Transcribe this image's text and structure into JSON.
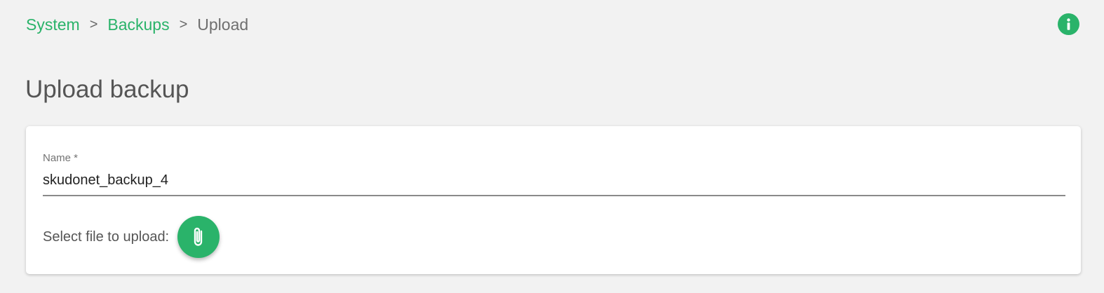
{
  "breadcrumb": {
    "items": [
      "System",
      "Backups"
    ],
    "separator": ">",
    "current": "Upload"
  },
  "header": {
    "info_icon": "info-icon"
  },
  "page": {
    "title": "Upload backup"
  },
  "form": {
    "name_label": "Name *",
    "name_value": "skudonet_backup_4",
    "upload_label": "Select file to upload:",
    "attach_icon": "paperclip-icon"
  },
  "colors": {
    "accent": "#2ab36a",
    "background": "#f2f2f2",
    "card": "#ffffff"
  }
}
